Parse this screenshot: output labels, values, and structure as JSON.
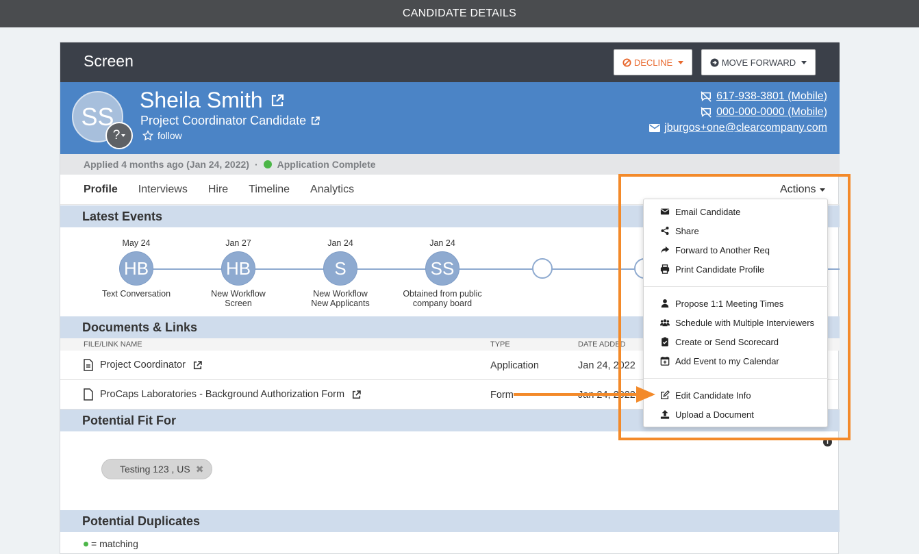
{
  "window": {
    "title": "CANDIDATE DETAILS"
  },
  "stage": {
    "title": "Screen",
    "decline_label": "DECLINE",
    "forward_label": "MOVE FORWARD"
  },
  "colors": {
    "decline": "#e8682d",
    "header": "#4b84c6",
    "highlight": "#f38a2a",
    "status_green": "#4cb648"
  },
  "candidate": {
    "initials": "SS",
    "badge": "?",
    "name": "Sheila Smith",
    "role": "Project Coordinator Candidate",
    "follow_label": "follow",
    "phones": [
      "617-938-3801 (Mobile)",
      "000-000-0000 (Mobile)"
    ],
    "email": "jburgos+one@clearcompany.com"
  },
  "applied": {
    "text": "Applied 4 months ago (Jan 24, 2022)",
    "separator": "·",
    "status": "Application Complete"
  },
  "tabs": [
    "Profile",
    "Interviews",
    "Hire",
    "Timeline",
    "Analytics"
  ],
  "actions_label": "Actions",
  "sections": {
    "latest_events": "Latest Events",
    "documents": "Documents & Links",
    "potential_fit": "Potential Fit For",
    "duplicates": "Potential Duplicates"
  },
  "events": [
    {
      "date": "May 24",
      "initials": "HB",
      "line1": "Text Conversation",
      "line2": ""
    },
    {
      "date": "Jan 27",
      "initials": "HB",
      "line1": "New Workflow",
      "line2": "Screen"
    },
    {
      "date": "Jan 24",
      "initials": "S",
      "line1": "New Workflow",
      "line2": "New Applicants"
    },
    {
      "date": "Jan 24",
      "initials": "SS",
      "line1": "Obtained from public",
      "line2": "company board"
    }
  ],
  "documents": {
    "headers": {
      "name": "FILE/LINK NAME",
      "type": "TYPE",
      "date": "DATE ADDED"
    },
    "rows": [
      {
        "name": "Project Coordinator",
        "type": "Application",
        "date": "Jan 24, 2022"
      },
      {
        "name": "ProCaps Laboratories - Background Authorization Form",
        "type": "Form",
        "date": "Jan 24, 2022"
      }
    ]
  },
  "potential_fit": {
    "chip": "Testing 123 , US",
    "remove": "✖"
  },
  "duplicates": {
    "legend": "= matching"
  },
  "actions_menu": {
    "group1": [
      "Email Candidate",
      "Share",
      "Forward to Another Req",
      "Print Candidate Profile"
    ],
    "group2": [
      "Propose 1:1 Meeting Times",
      "Schedule with Multiple Interviewers",
      "Create or Send Scorecard",
      "Add Event to my Calendar"
    ],
    "group3": [
      "Edit Candidate Info",
      "Upload a Document"
    ]
  },
  "icons": {
    "email": "envelope-icon",
    "share": "share-icon",
    "forward": "forward-arrow-icon",
    "print": "print-icon",
    "person": "person-icon",
    "group": "group-icon",
    "scorecard": "clipboard-check-icon",
    "calendar": "calendar-plus-icon",
    "edit": "edit-icon",
    "upload": "upload-icon"
  }
}
